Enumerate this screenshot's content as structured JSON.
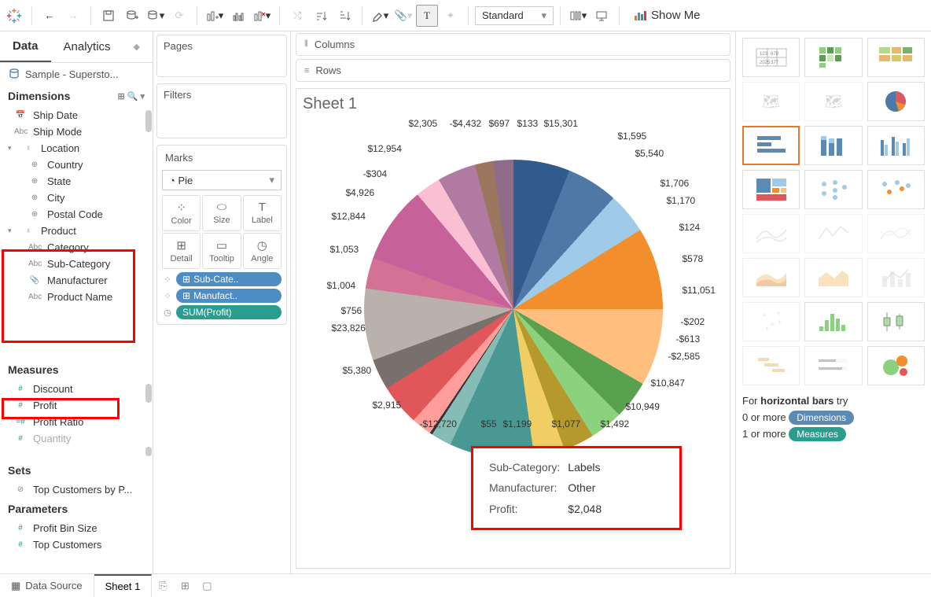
{
  "toolbar": {
    "fit": "Standard",
    "showme": "Show Me"
  },
  "sidebar": {
    "data_tab": "Data",
    "analytics_tab": "Analytics",
    "datasource": "Sample - Supersto...",
    "dimensions_hdr": "Dimensions",
    "measures_hdr": "Measures",
    "sets_hdr": "Sets",
    "parameters_hdr": "Parameters",
    "dim_fields": [
      "Ship Date",
      "Ship Mode",
      "Location",
      "Country",
      "State",
      "City",
      "Postal Code",
      "Product",
      "Category",
      "Sub-Category",
      "Manufacturer",
      "Product Name"
    ],
    "mea_fields": [
      "Discount",
      "Profit",
      "Profit Ratio",
      "Quantity"
    ],
    "sets": [
      "Top Customers by P..."
    ],
    "params": [
      "Profit Bin Size",
      "Top Customers"
    ]
  },
  "shelves": {
    "pages": "Pages",
    "filters": "Filters",
    "marks": "Marks",
    "mark_type": "Pie",
    "cells": [
      "Color",
      "Size",
      "Label",
      "Detail",
      "Tooltip",
      "Angle"
    ],
    "pills": [
      "Sub-Cate..",
      "Manufact..",
      "SUM(Profit)"
    ]
  },
  "viz": {
    "columns": "Columns",
    "rows": "Rows",
    "title": "Sheet 1",
    "labels": [
      "$2,305",
      "-$4,432",
      "$697",
      "$133",
      "$15,301",
      "$1,595",
      "$5,540",
      "$1,706",
      "$1,170",
      "$124",
      "$578",
      "$11,051",
      "-$202",
      "-$613",
      "-$2,585",
      "$10,847",
      "$10,949",
      "$1,492",
      "$1,077",
      "$1,199",
      "$55",
      "-$12,720",
      "$2,915",
      "$5,380",
      "$23,826",
      "$756",
      "$1,004",
      "$1,053",
      "$12,844",
      "$4,926",
      "-$304",
      "$12,954"
    ],
    "tooltip": {
      "k1": "Sub-Category:",
      "v1": "Labels",
      "k2": "Manufacturer:",
      "v2": "Other",
      "k3": "Profit:",
      "v3": "$2,048"
    }
  },
  "showme": {
    "hint1a": "For ",
    "hint1b": "horizontal bars ",
    "hint1c": "try",
    "hint2a": "0 or more ",
    "hint2b": "Dimensions",
    "hint3a": "1 or more ",
    "hint3b": "Measures"
  },
  "bottom": {
    "datasource": "Data Source",
    "sheet": "Sheet 1"
  },
  "chart_data": {
    "type": "pie",
    "title": "Sheet 1",
    "angle_measure": "SUM(Profit)",
    "color_dimension": "Sub-Category",
    "detail_dimension": "Manufacturer",
    "slice_labels_profit": [
      2305,
      -4432,
      697,
      133,
      15301,
      1595,
      5540,
      1706,
      1170,
      124,
      578,
      11051,
      -202,
      -613,
      -2585,
      10847,
      10949,
      1492,
      1077,
      1199,
      55,
      -12720,
      2915,
      5380,
      23826,
      756,
      1004,
      1053,
      12844,
      4926,
      -304,
      12954
    ],
    "tooltip_sample": {
      "Sub-Category": "Labels",
      "Manufacturer": "Other",
      "Profit": 2048
    },
    "approx_colors_cw_from_top": [
      "#315b8c",
      "#4e79a7",
      "#a0cbe8",
      "#f28e2b",
      "#ffbe7d",
      "#59a14f",
      "#8cd17d",
      "#b6992d",
      "#f1ce63",
      "#499894",
      "#86bcb6",
      "#e15759",
      "#ff9d9a",
      "#79706e",
      "#bab0ac",
      "#d37295",
      "#c6619a",
      "#b07aa1",
      "#9d7660",
      "#8e6c8a"
    ]
  }
}
